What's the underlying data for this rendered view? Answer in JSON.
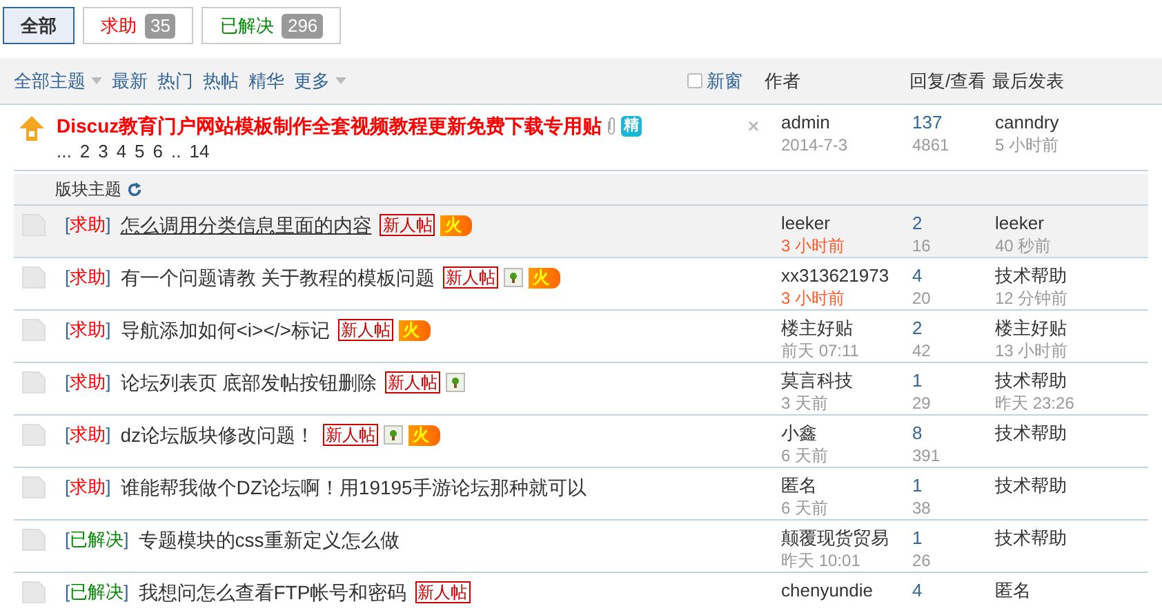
{
  "filter_tabs": [
    {
      "label": "全部",
      "kind": "all",
      "selected": true
    },
    {
      "label": "求助",
      "count": "35",
      "kind": "help",
      "selected": false
    },
    {
      "label": "已解决",
      "count": "296",
      "kind": "solved",
      "selected": false
    }
  ],
  "toolbar": {
    "menus": [
      {
        "label": "全部主题",
        "dropdown": true
      },
      {
        "label": "最新",
        "dropdown": false
      },
      {
        "label": "热门",
        "dropdown": false
      },
      {
        "label": "热帖",
        "dropdown": false
      },
      {
        "label": "精华",
        "dropdown": false
      },
      {
        "label": "更多",
        "dropdown": true
      }
    ],
    "new_window": {
      "label": "新窗",
      "checked": false
    },
    "columns": [
      "作者",
      "回复/查看",
      "最后发表"
    ]
  },
  "sticky": {
    "title": "Discuz教育门户网站模板制作全套视频教程更新免费下载专用贴",
    "digest_badge": "精",
    "close": "×",
    "pages": [
      "...",
      "2",
      "3",
      "4",
      "5",
      "6",
      "..",
      "14"
    ],
    "author": "admin",
    "date": "2014-7-3",
    "replies": "137",
    "views": "4861",
    "last_poster": "canndry",
    "last_time": "5 小时前"
  },
  "section": {
    "label": "版块主题"
  },
  "threads": [
    {
      "brackets": [
        "[",
        "]"
      ],
      "tag": "求助",
      "kind": "help",
      "title": "怎么调用分类信息里面的内容",
      "hovered": true,
      "badges": [
        {
          "kind": "new",
          "text": "新人帖"
        },
        {
          "kind": "hot",
          "text": "火"
        }
      ],
      "author": "leeker",
      "time": "3 小时前",
      "recent": true,
      "replies": "2",
      "views": "16",
      "last_poster": "leeker",
      "last_time": "40 秒前"
    },
    {
      "brackets": [
        "[",
        "]"
      ],
      "tag": "求助",
      "kind": "help",
      "title": "有一个问题请教 关于教程的模板问题",
      "hovered": false,
      "badges": [
        {
          "kind": "new",
          "text": "新人帖"
        },
        {
          "kind": "image"
        },
        {
          "kind": "hot",
          "text": "火"
        }
      ],
      "author": "xx313621973",
      "time": "3 小时前",
      "recent": true,
      "replies": "4",
      "views": "20",
      "last_poster": "技术帮助",
      "last_time": "12 分钟前"
    },
    {
      "brackets": [
        "[",
        "]"
      ],
      "tag": "求助",
      "kind": "help",
      "title": "导航添加如何<i></>标记",
      "hovered": false,
      "badges": [
        {
          "kind": "new",
          "text": "新人帖"
        },
        {
          "kind": "hot",
          "text": "火"
        }
      ],
      "author": "楼主好贴",
      "time": "前天 07:11",
      "recent": false,
      "replies": "2",
      "views": "42",
      "last_poster": "楼主好贴",
      "last_time": "13 小时前"
    },
    {
      "brackets": [
        "[",
        "]"
      ],
      "tag": "求助",
      "kind": "help",
      "title": "论坛列表页 底部发帖按钮删除",
      "hovered": false,
      "badges": [
        {
          "kind": "new",
          "text": "新人帖"
        },
        {
          "kind": "image"
        }
      ],
      "author": "莫言科技",
      "time": "3 天前",
      "recent": false,
      "replies": "1",
      "views": "29",
      "last_poster": "技术帮助",
      "last_time": "昨天 23:26"
    },
    {
      "brackets": [
        "[",
        "]"
      ],
      "tag": "求助",
      "kind": "help",
      "title": "dz论坛版块修改问题！",
      "hovered": false,
      "badges": [
        {
          "kind": "new",
          "text": "新人帖"
        },
        {
          "kind": "image"
        },
        {
          "kind": "hot",
          "text": "火"
        }
      ],
      "author": "小鑫",
      "time": "6 天前",
      "recent": false,
      "replies": "8",
      "views": "391",
      "last_poster": "技术帮助"
    },
    {
      "brackets": [
        "[",
        "]"
      ],
      "tag": "求助",
      "kind": "help",
      "title": "谁能帮我做个DZ论坛啊！用19195手游论坛那种就可以",
      "hovered": false,
      "author": "匿名",
      "time": "6 天前",
      "recent": false,
      "replies": "1",
      "views": "38",
      "last_poster": "技术帮助"
    },
    {
      "brackets": [
        "[",
        "]"
      ],
      "tag": "已解决",
      "kind": "solved",
      "title": "专题模块的css重新定义怎么做",
      "hovered": false,
      "author": "颠覆现货贸易",
      "time": "昨天 10:01",
      "recent": false,
      "replies": "1",
      "views": "26",
      "last_poster": "技术帮助"
    },
    {
      "brackets": [
        "[",
        "]"
      ],
      "tag": "已解决",
      "kind": "solved",
      "title": "我想问怎么查看FTP帐号和密码",
      "hovered": false,
      "badges": [
        {
          "kind": "new",
          "text": "新人帖"
        }
      ],
      "author": "chenyundie",
      "replies": "4",
      "last_poster": "匿名"
    }
  ]
}
